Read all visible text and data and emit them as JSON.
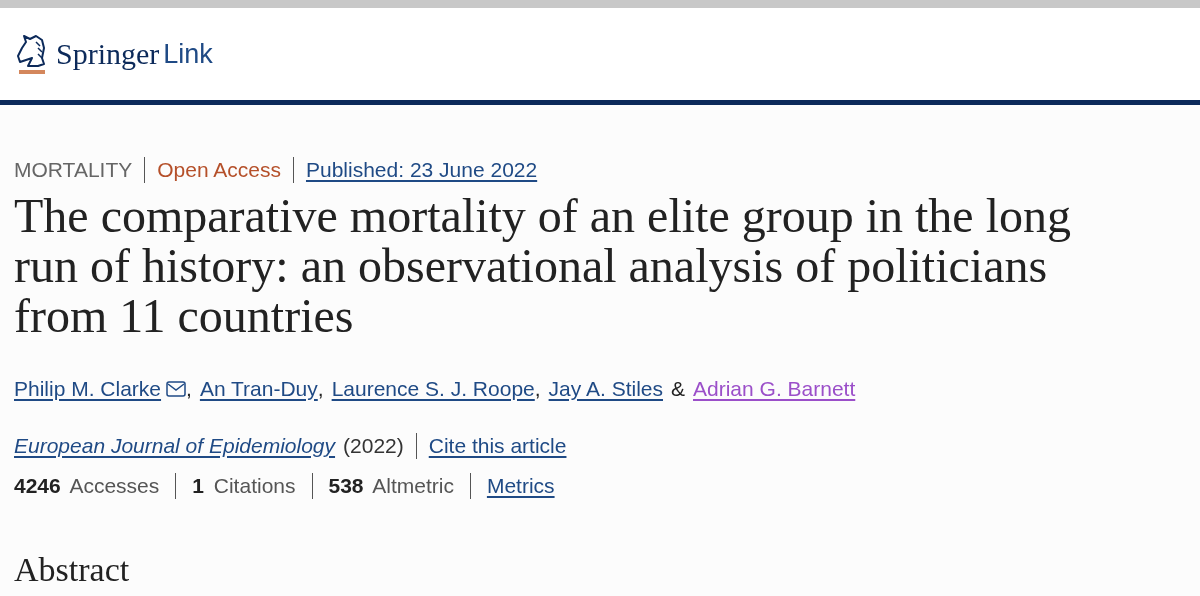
{
  "header": {
    "brand": "Springer",
    "product": "Link"
  },
  "article": {
    "subject": "MORTALITY",
    "access": "Open Access",
    "published": "Published: 23 June 2022",
    "title": "The comparative mortality of an elite group in the long run of history: an observational analysis of politicians from 11 countries",
    "authors": [
      {
        "name": "Philip M. Clarke",
        "contact": true,
        "visited": false,
        "separator": ","
      },
      {
        "name": "An Tran-Duy",
        "contact": false,
        "visited": false,
        "separator": ","
      },
      {
        "name": "Laurence S. J. Roope",
        "contact": false,
        "visited": false,
        "separator": ","
      },
      {
        "name": "Jay A. Stiles",
        "contact": false,
        "visited": false,
        "separator": "&"
      },
      {
        "name": "Adrian G. Barnett",
        "contact": false,
        "visited": true
      }
    ],
    "journal": "European Journal of Epidemiology",
    "year": "(2022)",
    "cite": "Cite this article",
    "metrics": [
      "**4246** Accesses",
      "**1** Citations",
      "**538** Altmetric"
    ],
    "metrics_link": "Metrics",
    "section": "Abstract"
  }
}
